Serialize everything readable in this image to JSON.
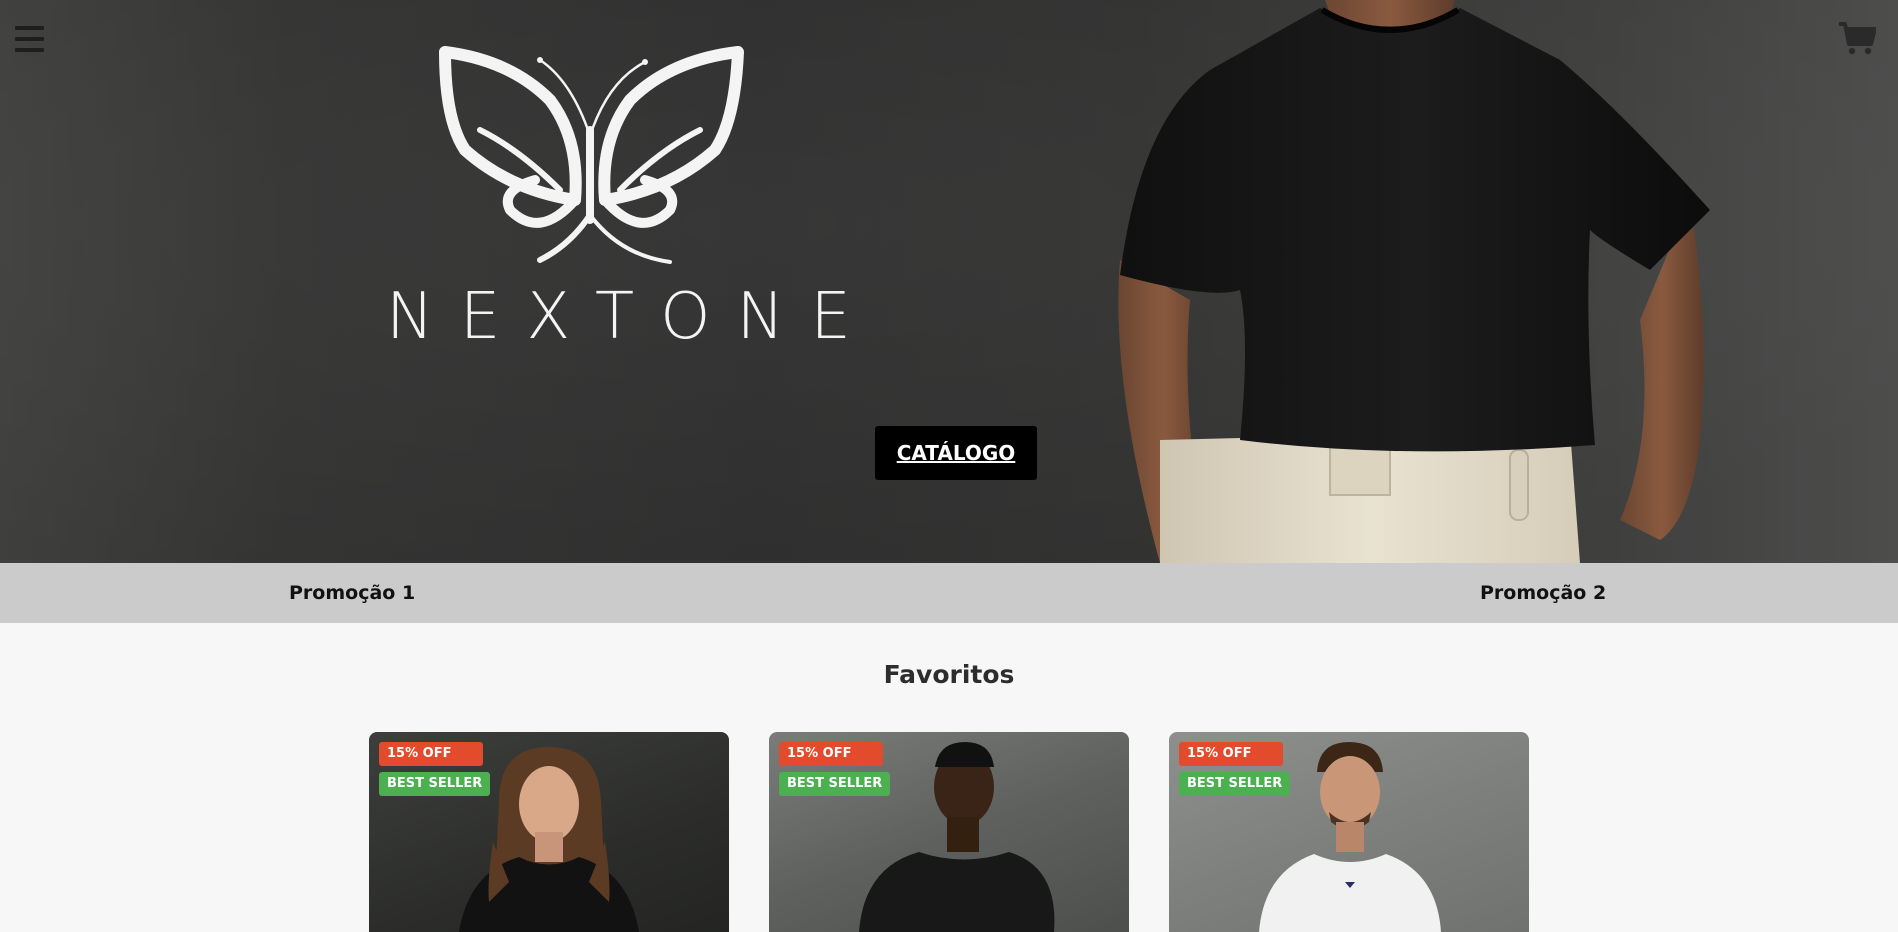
{
  "header": {
    "menu_icon": "hamburger-menu-icon",
    "cart_icon": "shopping-cart-icon"
  },
  "hero": {
    "brand_name": "NEXTONE",
    "logo_icon": "butterfly-logo",
    "catalog_button": "CATÁLOGO"
  },
  "promo_bar": {
    "items": [
      {
        "label": "Promoção 1"
      },
      {
        "label": "Promoção 2"
      }
    ]
  },
  "favorites": {
    "title": "Favoritos",
    "products": [
      {
        "discount_badge": "15% OFF",
        "status_badge": "BEST SELLER",
        "shirt_color": "black"
      },
      {
        "discount_badge": "15% OFF",
        "status_badge": "BEST SELLER",
        "shirt_color": "black"
      },
      {
        "discount_badge": "15% OFF",
        "status_badge": "BEST SELLER",
        "shirt_color": "white"
      }
    ]
  },
  "colors": {
    "discount_badge": "#e24b2b",
    "bestseller_badge": "#4caf50",
    "promo_bar": "#cbcbcb",
    "button": "#000000"
  }
}
